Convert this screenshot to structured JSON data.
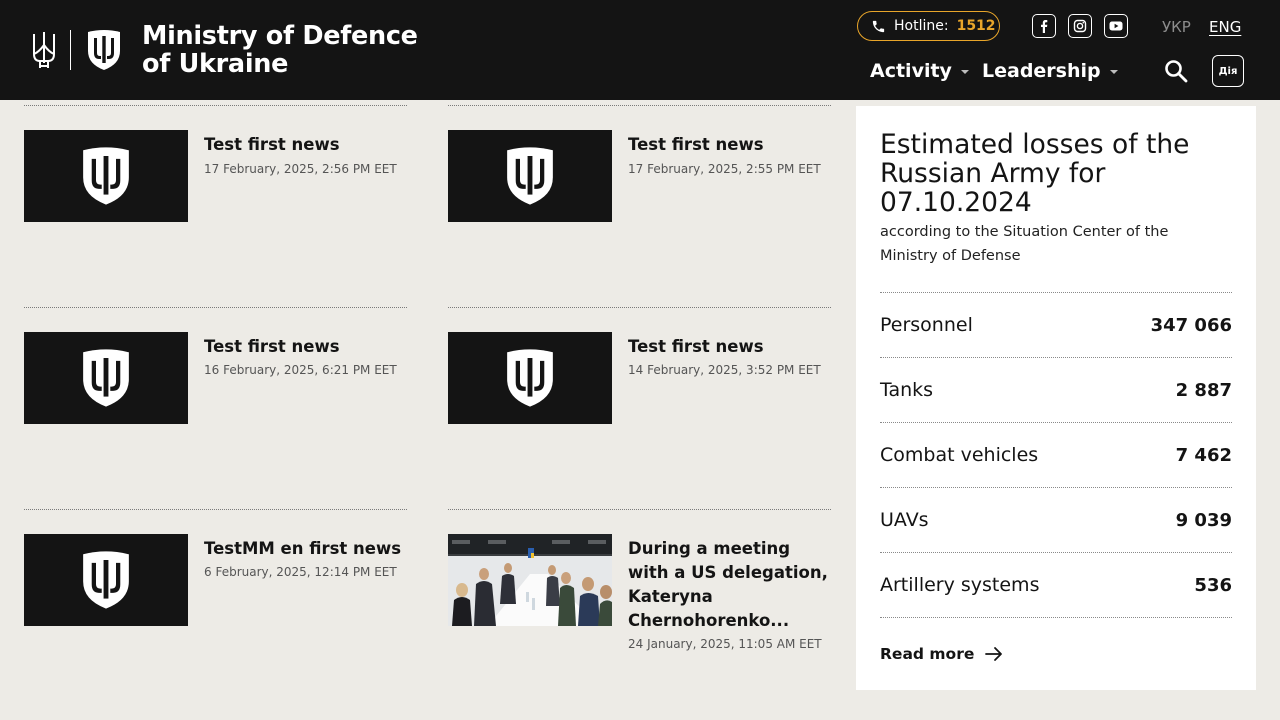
{
  "header": {
    "logo_text_line1": "Ministry of Defence",
    "logo_text_line2": "of Ukraine",
    "hotline_label": "Hotline:",
    "hotline_number": "1512",
    "lang_ukr": "УКР",
    "lang_eng": "ENG",
    "nav": [
      {
        "label": "Activity"
      },
      {
        "label": "Leadership"
      }
    ],
    "diia_label": "Дія",
    "accent_color": "#e8a52a",
    "bg_color": "#141414"
  },
  "news": [
    {
      "title": "Test first news",
      "date": "17 February, 2025, 2:56 PM EET",
      "image": "mod-shield-emblem"
    },
    {
      "title": "Test first news",
      "date": "17 February, 2025, 2:55 PM EET",
      "image": "mod-shield-emblem"
    },
    {
      "title": "Test first news",
      "date": "16 February, 2025, 6:21 PM EET",
      "image": "mod-shield-emblem"
    },
    {
      "title": "Test first news",
      "date": "14 February, 2025, 3:52 PM EET",
      "image": "mod-shield-emblem"
    },
    {
      "title": "TestMM en first news",
      "date": "6 February, 2025, 12:14 PM EET",
      "image": "mod-shield-emblem"
    },
    {
      "title": "During a meeting with a US delegation, Kateryna Chernohorenko...",
      "date": "24 January, 2025, 11:05 AM EET",
      "image": "meeting-photo"
    }
  ],
  "losses": {
    "heading": "Estimated losses of the Russian Army for 07.10.2024",
    "subheading": "according to the Situation Center of the Ministry of Defense",
    "rows": [
      {
        "label": "Personnel",
        "value": "347 066"
      },
      {
        "label": "Tanks",
        "value": "2 887"
      },
      {
        "label": "Combat vehicles",
        "value": "7 462"
      },
      {
        "label": "UAVs",
        "value": "9 039"
      },
      {
        "label": "Artillery systems",
        "value": "536"
      }
    ],
    "read_more": "Read more"
  }
}
